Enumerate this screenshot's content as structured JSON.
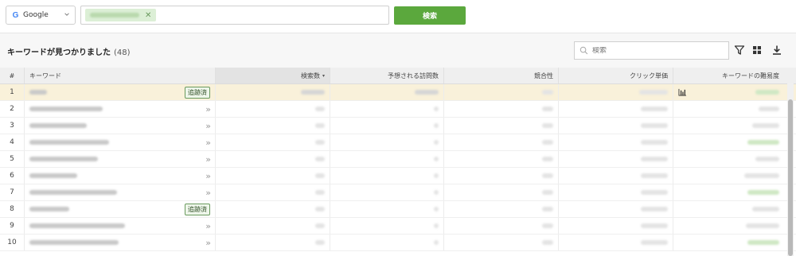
{
  "search": {
    "engine_label": "Google",
    "chip_close": "✕",
    "search_button": "検索"
  },
  "results": {
    "title": "キーワードが見つかりました",
    "count": "(48)",
    "filter_placeholder": "検索"
  },
  "table": {
    "headers": {
      "num": "#",
      "keyword": "キーワード",
      "volume": "検索数",
      "visits": "予想される訪問数",
      "competition": "競合性",
      "cpc": "クリック単価",
      "difficulty": "キーワードの難易度"
    },
    "sort_caret": "▾",
    "tracked_label": "追跡済",
    "add_label": "»",
    "rows": [
      {
        "num": "1",
        "tracked": true
      },
      {
        "num": "2",
        "tracked": false
      },
      {
        "num": "3",
        "tracked": false
      },
      {
        "num": "4",
        "tracked": false
      },
      {
        "num": "5",
        "tracked": false
      },
      {
        "num": "6",
        "tracked": false
      },
      {
        "num": "7",
        "tracked": false
      },
      {
        "num": "8",
        "tracked": true
      },
      {
        "num": "9",
        "tracked": false
      },
      {
        "num": "10",
        "tracked": false
      }
    ]
  },
  "colors": {
    "accent": "#5ba83d",
    "highlight_row": "#f9f1da"
  },
  "icons": [
    "google-icon",
    "chevron-down-icon",
    "close-icon",
    "search-icon",
    "filter-icon",
    "grid-icon",
    "download-icon",
    "double-chevron-right-icon",
    "bar-chart-icon"
  ]
}
